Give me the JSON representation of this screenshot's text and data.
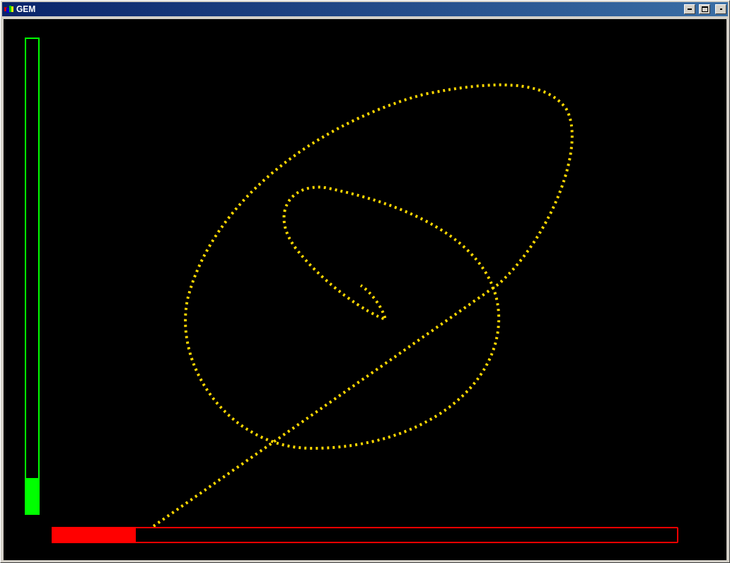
{
  "window": {
    "title": "GEM"
  },
  "meters": [
    {
      "kind": "vertical",
      "level": 0.075,
      "color": "#00ff00"
    },
    {
      "kind": "horizontal",
      "level": 0.133,
      "color": "#ff0000"
    }
  ]
}
